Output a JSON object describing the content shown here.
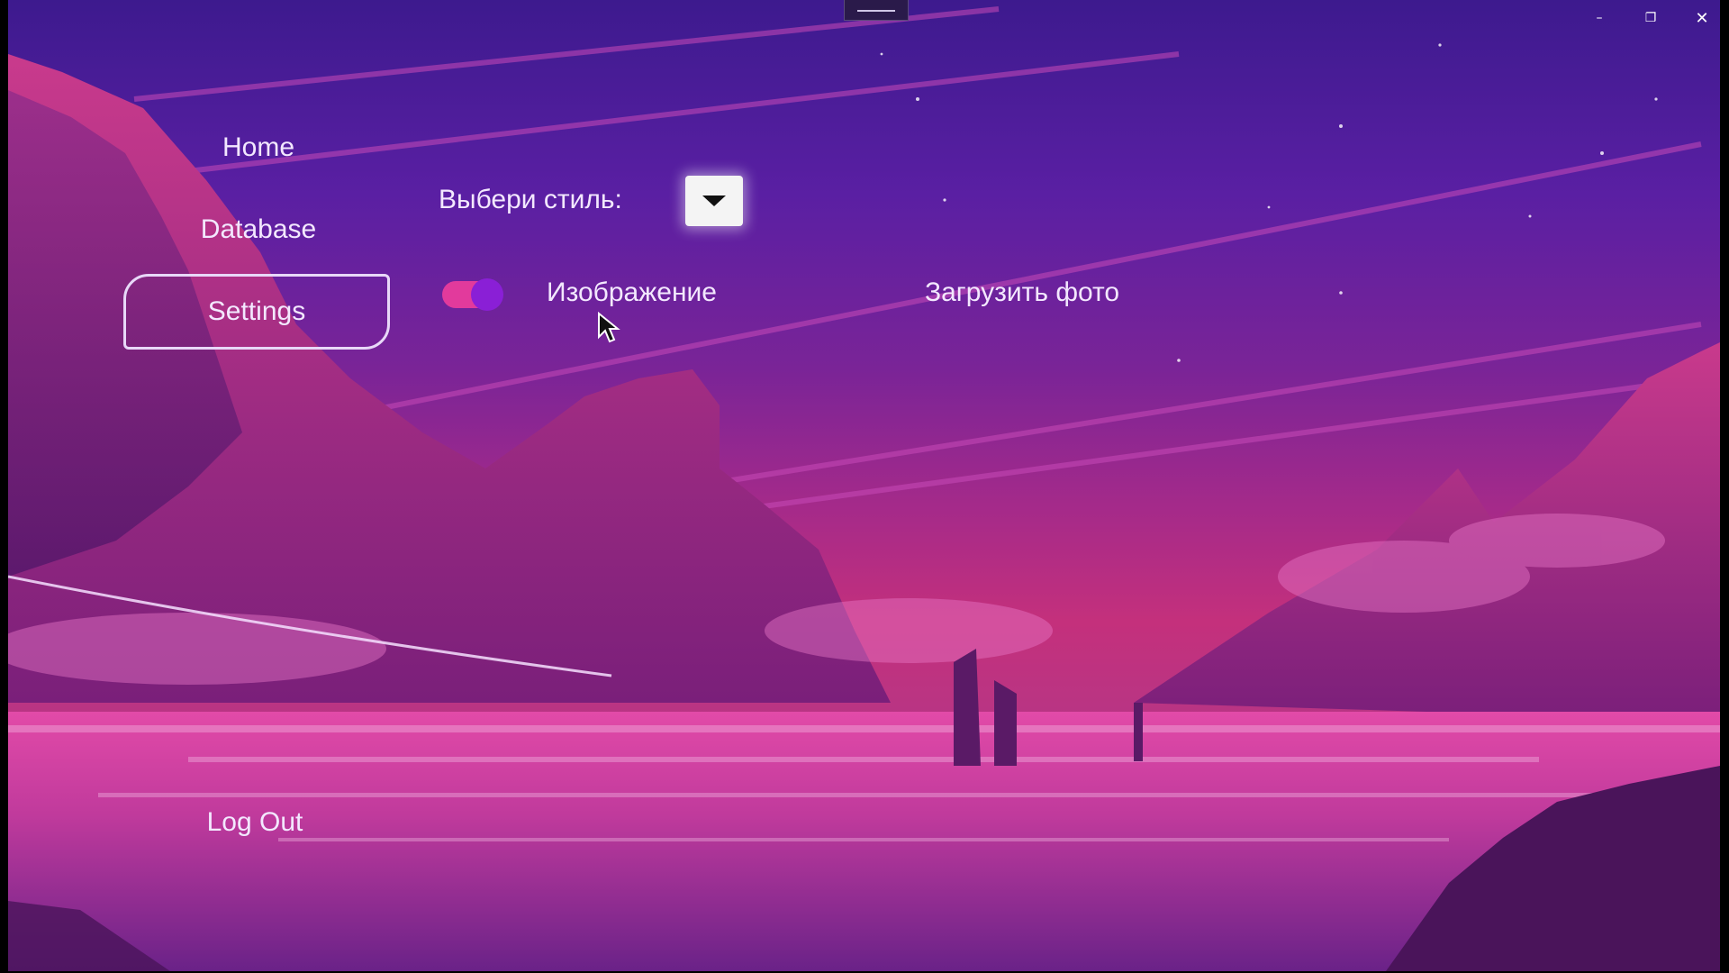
{
  "window": {
    "controls": {
      "minimize": "–",
      "maximize": "❐",
      "close": "✕"
    }
  },
  "nav": {
    "home": "Home",
    "database": "Database",
    "settings": "Settings",
    "logout": "Log Out",
    "active": "settings"
  },
  "settings": {
    "style_label": "Выбери стиль:",
    "style_dropdown_icon": "chevron-down-icon",
    "image_toggle": {
      "label": "Изображение",
      "on": true
    },
    "upload_label": "Загрузить фото"
  },
  "colors": {
    "toggle_track": "#e23a9c",
    "toggle_knob": "#8a1fd6",
    "text": "#f3e8ff"
  }
}
